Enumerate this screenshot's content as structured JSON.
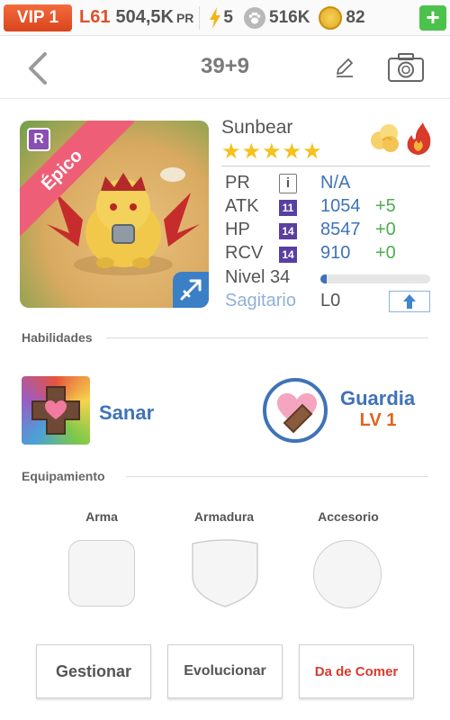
{
  "status_bar": {
    "vip": "VIP 1",
    "level": "L61",
    "pr_value": "504,5K",
    "pr_suffix": "PR",
    "energy": "5",
    "paw_points": "516K",
    "coins": "82",
    "plus_label": "+"
  },
  "header": {
    "title": "39+9"
  },
  "monster": {
    "rarity": "Épico",
    "rank_badge": "R",
    "name": "Sunbear",
    "star_count": 5,
    "stats": {
      "pr": {
        "label": "PR",
        "value": "N/A"
      },
      "atk": {
        "label": "ATK",
        "badge": "11",
        "value": "1054",
        "bonus": "+5"
      },
      "hp": {
        "label": "HP",
        "badge": "14",
        "value": "8547",
        "bonus": "+0"
      },
      "rcv": {
        "label": "RCV",
        "badge": "14",
        "value": "910",
        "bonus": "+0"
      },
      "level": {
        "label": "Nivel 34",
        "progress": 0.06
      },
      "sign": {
        "label": "Sagitario",
        "value": "L0"
      }
    },
    "colors": {
      "stat_value": "#3f73b8",
      "bonus": "#4cae4c",
      "sign": "#8fb1d8"
    }
  },
  "skills": {
    "section_title": "Habilidades",
    "heal": {
      "name": "Sanar",
      "icon": "heal-skill-icon"
    },
    "guard": {
      "name": "Guardia",
      "level": "LV 1",
      "icon": "guard-skill-icon"
    }
  },
  "equipment": {
    "section_title": "Equipamiento",
    "slots": [
      "Arma",
      "Armadura",
      "Accesorio"
    ]
  },
  "actions": {
    "manage": "Gestionar",
    "evolve": "Evolucionar",
    "feed": "Da de Comer"
  }
}
